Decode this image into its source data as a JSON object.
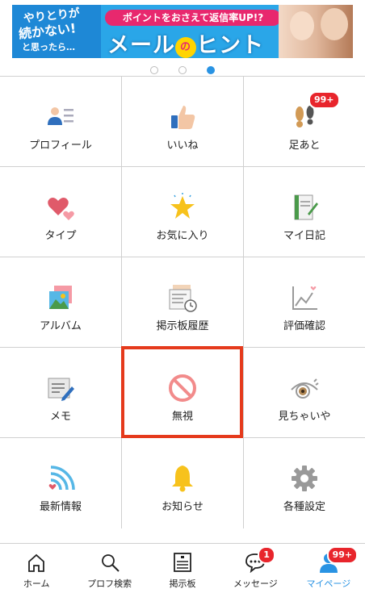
{
  "banner": {
    "line1": "やりとりが",
    "line2": "続かない!",
    "line3": "と思ったら…",
    "pill": "ポイントをおさえて返信率UP!?",
    "headline_a": "メール",
    "headline_o": "の",
    "headline_b": "ヒント"
  },
  "carousel": {
    "count": 3,
    "active_index": 3
  },
  "menu": [
    {
      "label": "プロフィール",
      "icon": "profile-icon"
    },
    {
      "label": "いいね",
      "icon": "thumbs-up-icon"
    },
    {
      "label": "足あと",
      "icon": "footprints-icon",
      "badge": "99+"
    },
    {
      "label": "タイプ",
      "icon": "hearts-icon"
    },
    {
      "label": "お気に入り",
      "icon": "star-icon"
    },
    {
      "label": "マイ日記",
      "icon": "diary-icon"
    },
    {
      "label": "アルバム",
      "icon": "album-icon"
    },
    {
      "label": "掲示板履歴",
      "icon": "board-history-icon"
    },
    {
      "label": "評価確認",
      "icon": "chart-icon"
    },
    {
      "label": "メモ",
      "icon": "memo-icon"
    },
    {
      "label": "無視",
      "icon": "ignore-icon"
    },
    {
      "label": "見ちゃいや",
      "icon": "eye-icon"
    },
    {
      "label": "最新情報",
      "icon": "news-icon"
    },
    {
      "label": "お知らせ",
      "icon": "bell-icon"
    },
    {
      "label": "各種設定",
      "icon": "gear-icon"
    }
  ],
  "nav": [
    {
      "label": "ホーム",
      "icon": "home-icon"
    },
    {
      "label": "プロフ検索",
      "icon": "search-icon"
    },
    {
      "label": "掲示板",
      "icon": "board-icon"
    },
    {
      "label": "メッセージ",
      "icon": "message-icon",
      "badge": "1"
    },
    {
      "label": "マイページ",
      "icon": "mypage-icon",
      "badge": "99+",
      "active": true
    }
  ],
  "colors": {
    "accent": "#2993e3",
    "badge": "#e8252c",
    "highlight": "#e53a1c"
  }
}
